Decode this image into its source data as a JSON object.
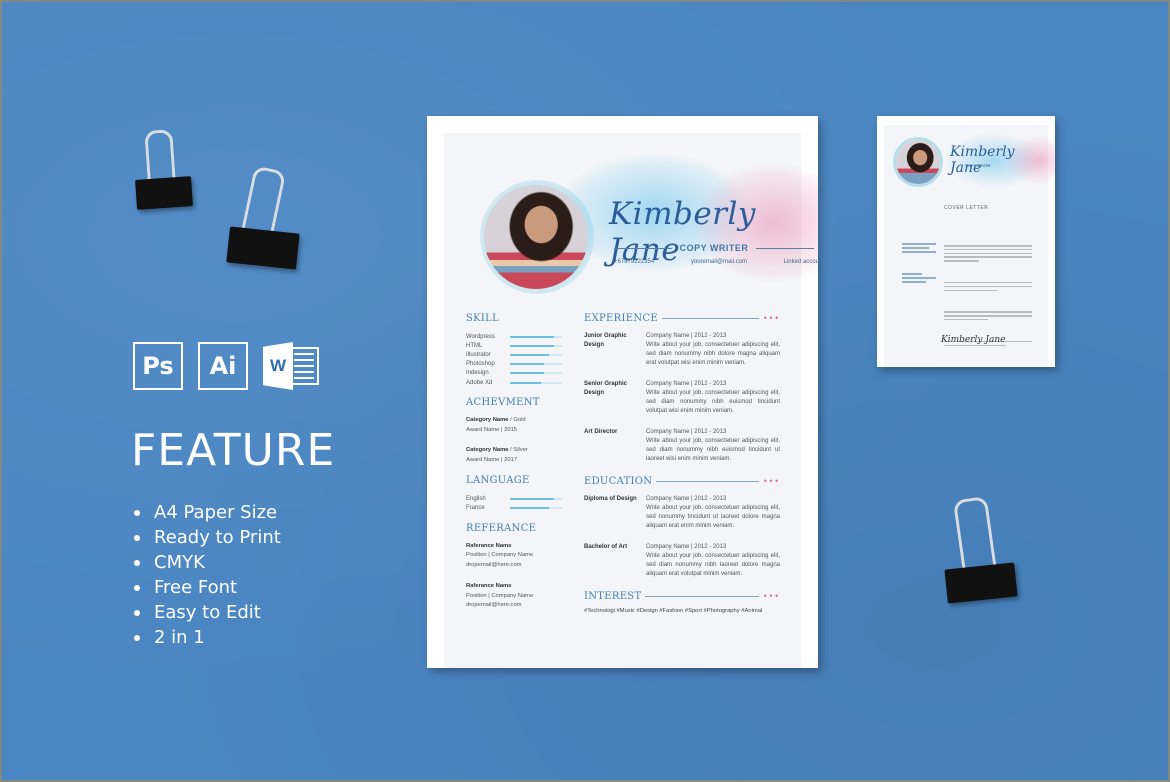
{
  "feature_panel": {
    "software_icons": [
      {
        "name": "photoshop",
        "label": "Ps"
      },
      {
        "name": "illustrator",
        "label": "Ai"
      },
      {
        "name": "word",
        "label": "W"
      }
    ],
    "title": "FEATURE",
    "items": [
      "A4 Paper Size",
      "Ready to Print",
      "CMYK",
      "Free Font",
      "Easy to Edit",
      "2 in 1"
    ]
  },
  "resume": {
    "name": "Kimberly Jane",
    "role": "COPY WRITER",
    "contact": {
      "phone": "+67979222354",
      "email": "youremail@mail.com",
      "link": "Linked account"
    },
    "skill": {
      "heading": "SKILL",
      "items": [
        {
          "label": "Wordpress",
          "level": 0.85
        },
        {
          "label": "HTML",
          "level": 0.85
        },
        {
          "label": "Illustrator",
          "level": 0.75
        },
        {
          "label": "Photoshop",
          "level": 0.65
        },
        {
          "label": "Indesign",
          "level": 0.65
        },
        {
          "label": "Adobe Xd",
          "level": 0.6
        }
      ]
    },
    "achievement": {
      "heading": "ACHEVMENT",
      "items": [
        {
          "category": "Category Name",
          "tier": " / Gold",
          "award": "Award Name | 2015"
        },
        {
          "category": "Category Name",
          "tier": " / Silver",
          "award": "Award Name | 2017"
        }
      ]
    },
    "language": {
      "heading": "LANGUAGE",
      "items": [
        {
          "label": "English",
          "level": 0.85
        },
        {
          "label": "France",
          "level": 0.75
        }
      ]
    },
    "reference": {
      "heading": "REFERANCE",
      "items": [
        {
          "name": "Raferance Name",
          "position": "Position | Company Name",
          "email": "dropemail@here.com"
        },
        {
          "name": "Raferance Name",
          "position": "Position | Company Name",
          "email": "dropemail@here.com"
        }
      ]
    },
    "experience": {
      "heading": "EXPERIENCE",
      "items": [
        {
          "title": "Junior Graphic Design",
          "company": "Company Name | 2012 - 2013",
          "desc": "Write about your job, consectetuer adipiscing elit, sed diam nonummy nibh dolore magna aliquam erat volutpat wisi enim minim veniam."
        },
        {
          "title": "Senior Graphic Design",
          "company": "Company Name | 2012 - 2013",
          "desc": "Write about your job, consectetuer adipiscing elit, sed diam nonummy nibh euismod tincidunt volutpat wisi enim minim veniam."
        },
        {
          "title": "Art Director",
          "company": "Company Name | 2012 - 2013",
          "desc": "Write about your job, consectetuer adipiscing elit, sed diam nonummy nibh euismod tincidunt ut laoreet wisi enim minim veniam."
        }
      ]
    },
    "education": {
      "heading": "EDUCATION",
      "items": [
        {
          "title": "Diploma of Design",
          "company": "Company Name | 2012 - 2013",
          "desc": "Write about your job, consectetuer adipiscing elit, sed nonummy tincidunt ut laoreet dolore magna aliquam erat enim minim veniam."
        },
        {
          "title": "Bachelor of Art",
          "company": "Company Name | 2012 - 2013",
          "desc": "Write about your job, consectetuer adipiscing elit, sed diam nonummy nibh laoreet dolore magna aliquam erat volutpat minim veniam."
        }
      ]
    },
    "interest": {
      "heading": "INTEREST",
      "tags": "#Technologi #Music #Design #Fashion #Sport #Photography #Animal"
    },
    "dots": "•••"
  },
  "cover_letter": {
    "name": "Kimberly Jane",
    "role": "COPY WRITER",
    "title": "COVER LETTER",
    "signature": "Kimberly Jane"
  }
}
